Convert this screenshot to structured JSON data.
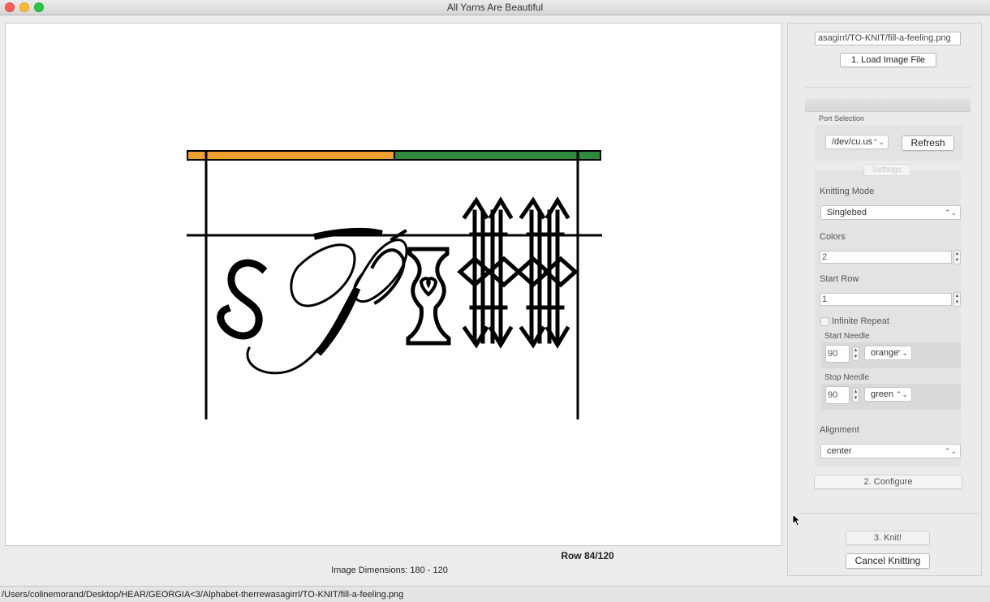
{
  "window": {
    "title": "All Yarns Are Beautiful"
  },
  "preview": {
    "row_label": "Row 84/120",
    "dimensions_label": "Image Dimensions: 180 - 120",
    "colors": {
      "left_color": "#f0a030",
      "right_color": "#2f8a3e",
      "ink": "#000000"
    }
  },
  "status_path": "/Users/colinemorand/Desktop/HEAR/GEORGIA<3/Alphabet-therrewasagirrl/TO-KNIT/fill-a-feeling.png",
  "sidebar": {
    "file_path_value": "asagirrl/TO-KNIT/fill-a-feeling.png",
    "load_button": "1. Load Image File",
    "port_section": {
      "title": "Port Selection",
      "port_value": "/dev/cu.us",
      "refresh_button": "Refresh"
    },
    "settings_tab": "Settings",
    "knitting_mode": {
      "label": "Knitting Mode",
      "value": "Singlebed"
    },
    "colors": {
      "label": "Colors",
      "value": "2"
    },
    "start_row": {
      "label": "Start Row",
      "value": "1"
    },
    "infinite_repeat": {
      "label": "Infinite Repeat",
      "checked": false
    },
    "start_needle": {
      "label": "Start Needle",
      "value": "90",
      "color": "orange"
    },
    "stop_needle": {
      "label": "Stop Needle",
      "value": "90",
      "color": "green"
    },
    "alignment": {
      "label": "Alignment",
      "value": "center"
    },
    "configure_button": "2. Configure",
    "knit_button": "3. Knit!",
    "cancel_button": "Cancel Knitting"
  },
  "icons": {
    "chevron": "chevron-updown-icon",
    "cursor": "mouse-pointer-icon"
  }
}
